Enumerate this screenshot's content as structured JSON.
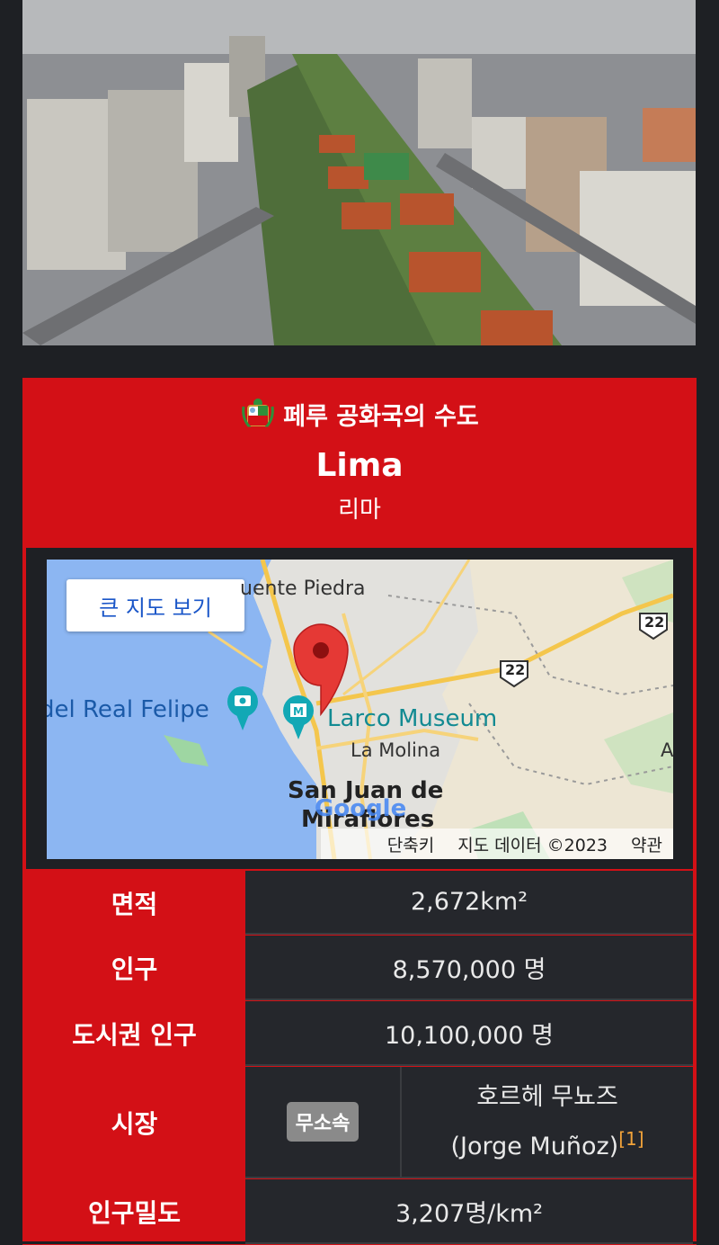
{
  "hero": {
    "icon": "lima-aerial-photo"
  },
  "infobox": {
    "capital_title": "페루 공화국의 수도",
    "name_en": "Lima",
    "name_ko": "리마",
    "map": {
      "button_label": "큰 지도 보기",
      "labels": {
        "puente": "uente Piedra",
        "real_felipe": "del Real Felipe",
        "larco": "Larco Museum",
        "molina": "La Molina",
        "san_juan_1": "San Juan de",
        "san_juan_2": "Miraflores",
        "a_edge": "A",
        "route_22a": "22",
        "route_22b": "22",
        "google": "Google"
      },
      "footer": {
        "shortcuts": "단축키",
        "map_data": "지도 데이터 ©2023",
        "terms": "약관"
      }
    },
    "rows": {
      "area": {
        "label": "면적",
        "value": "2,672km²"
      },
      "population": {
        "label": "인구",
        "value": "8,570,000 명"
      },
      "metro": {
        "label": "도시권 인구",
        "value": "10,100,000 명"
      },
      "mayor": {
        "label": "시장",
        "party": "무소속",
        "name_ko": "호르헤 무뇨즈",
        "name_en": "(Jorge Muñoz)",
        "ref": "[1]"
      },
      "density": {
        "label": "인구밀도",
        "value": "3,207명/km²"
      }
    }
  },
  "colors": {
    "accent": "#d31016",
    "background": "#1e2024",
    "cell": "#25272c",
    "ref": "#f2a33a"
  }
}
